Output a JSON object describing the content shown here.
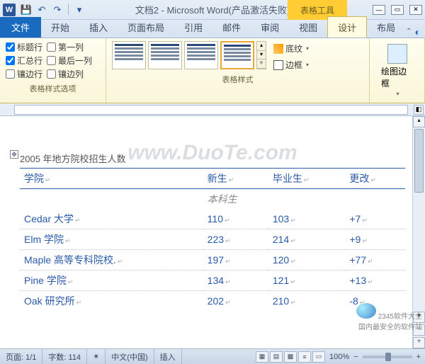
{
  "title": "文档2 - Microsoft Word(产品激活失败)",
  "context_tab": "表格工具",
  "tabs": {
    "file": "文件",
    "items": [
      "开始",
      "插入",
      "页面布局",
      "引用",
      "邮件",
      "审阅",
      "视图",
      "设计",
      "布局"
    ],
    "active": "设计"
  },
  "ribbon": {
    "options_group": "表格样式选项",
    "styles_group": "表格样式",
    "checks": {
      "header_row": "标题行",
      "first_col": "第一列",
      "total_row": "汇总行",
      "last_col": "最后一列",
      "banded_row": "镶边行",
      "banded_col": "镶边列"
    },
    "shading": "底纹",
    "borders": "边框",
    "draw_borders": "绘图边框"
  },
  "document": {
    "caption": "2005  年地方院校招生人数",
    "headers": [
      "学院",
      "新生",
      "毕业生",
      "更改"
    ],
    "subheader": "本科生",
    "rows": [
      {
        "c0": "Cedar 大学",
        "c1": "110",
        "c2": "103",
        "c3": "+7"
      },
      {
        "c0": "Elm 学院",
        "c1": "223",
        "c2": "214",
        "c3": "+9"
      },
      {
        "c0": "Maple 高等专科院校.",
        "c1": "197",
        "c2": "120",
        "c3": "+77"
      },
      {
        "c0": "Pine 学院",
        "c1": "134",
        "c2": "121",
        "c3": "+13"
      },
      {
        "c0": "Oak 研究所",
        "c1": "202",
        "c2": "210",
        "c3": "-8"
      }
    ]
  },
  "watermark": "www.DuoTe.com",
  "status": {
    "page": "页面: 1/1",
    "words": "字数: 114",
    "lang": "中文(中国)",
    "mode": "插入",
    "zoom": "100%",
    "zoom_minus": "−",
    "zoom_plus": "+"
  },
  "corner": {
    "brand": "2345软件大全",
    "tag": "国内最安全的软件站"
  }
}
